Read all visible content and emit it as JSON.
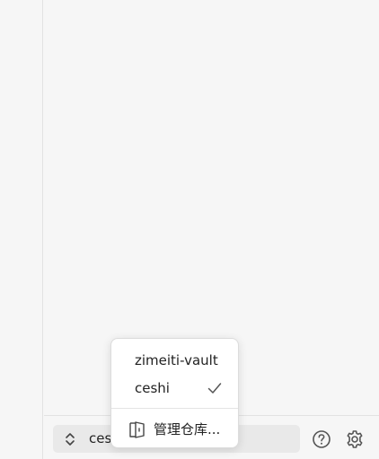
{
  "vault_switcher": {
    "current_label": "ceshi",
    "icon": "chevron-up-down-icon"
  },
  "bottom_bar": {
    "help_icon": "help-circle-icon",
    "settings_icon": "gear-icon"
  },
  "vault_menu": {
    "items": [
      {
        "label": "zimeiti-vault",
        "selected": false
      },
      {
        "label": "ceshi",
        "selected": true
      }
    ],
    "manage_label": "管理仓库...",
    "manage_icon": "vault-door-icon",
    "check_icon": "checkmark-icon"
  },
  "colors": {
    "background": "#f6f6f6",
    "switcher_bg": "#e9e9e9",
    "menu_bg": "#ffffff",
    "border": "#e2e2e2"
  }
}
